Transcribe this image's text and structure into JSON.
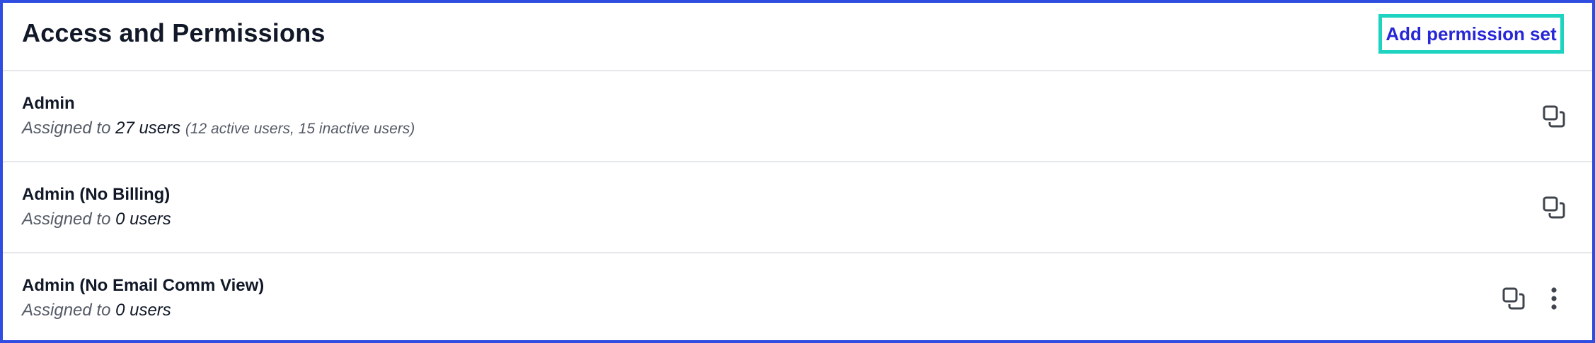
{
  "header": {
    "title": "Access and Permissions",
    "add_label": "Add permission set"
  },
  "rows": [
    {
      "name": "Admin",
      "assigned_prefix": "Assigned to",
      "count": "27 users",
      "detail": "(12 active users, 15 inactive users)",
      "icons": [
        "copy-icon"
      ]
    },
    {
      "name": "Admin (No Billing)",
      "assigned_prefix": "Assigned to",
      "count": "0 users",
      "icons": [
        "copy-icon"
      ]
    },
    {
      "name": "Admin (No Email Comm View)",
      "assigned_prefix": "Assigned to",
      "count": "0 users",
      "icons": [
        "copy-icon",
        "more-vertical-icon"
      ]
    }
  ],
  "colors": {
    "border_frame": "#2f4de0",
    "accent_link": "#2727d8",
    "highlight_outline": "#1fd3c1",
    "divider": "#e5e7eb",
    "icon": "#3f444c"
  }
}
